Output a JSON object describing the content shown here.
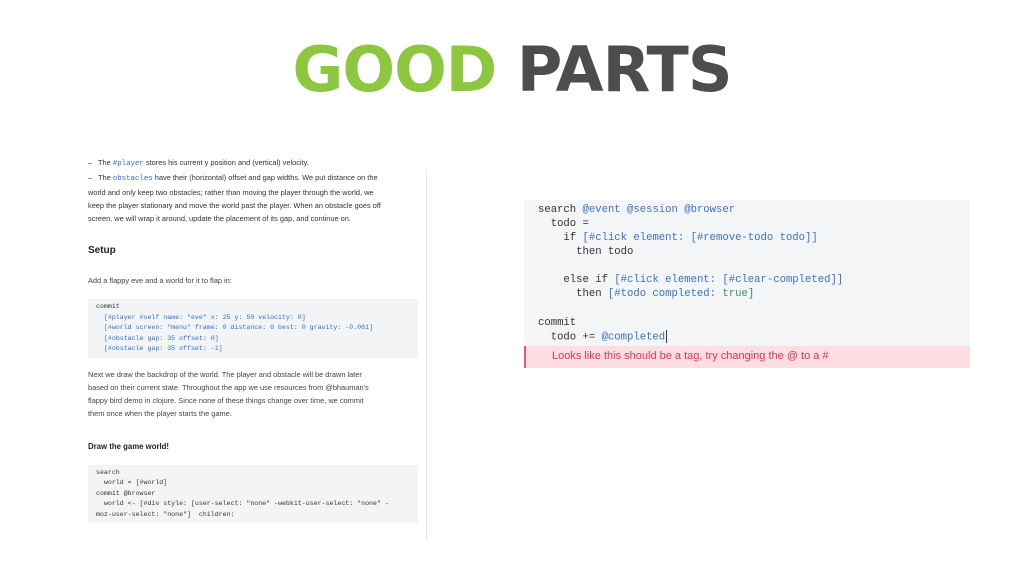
{
  "title": {
    "good": "GOOD",
    "parts": "PARTS"
  },
  "doc": {
    "bullet1": {
      "before": "The ",
      "code": "#player",
      "after": " stores his current y position and (vertical) velocity."
    },
    "bullet2": {
      "before": "The ",
      "code": "obstacles",
      "line1": " have their (horizontal) offset and gap widths. We put distance on the",
      "line2": "world and only keep two obstacles; rather than moving the player through the world, we",
      "line3": "keep the player stationary and move the world past the player. When an obstacle goes off",
      "line4": "screen, we will wrap it around, update the placement of its gap, and continue on."
    },
    "setup_heading": "Setup",
    "setup_text": "Add a flappy eve and a world for it to flap in:",
    "setup_code": [
      "commit",
      "  [#player #self name: \"eve\" x: 25 y: 50 velocity: 0]",
      "  [#world screen: \"menu\" frame: 0 distance: 0 best: 0 gravity: -0.061]",
      "  [#obstacle gap: 35 offset: 0]",
      "  [#obstacle gap: 35 offset: -1]"
    ],
    "para2": [
      "Next we draw the backdrop of the world. The player and obstacle will be drawn later",
      "based on their current state. Throughout the app we use resources from @bhauman's",
      "flappy bird demo in clojure. Since none of these things change over time, we commit",
      "them once when the player starts the game."
    ],
    "draw_heading": "Draw the game world!",
    "draw_code": [
      "search",
      "  world = [#world]",
      "",
      "commit @browser",
      "  world <- [#div style: [user-select: \"none\" -webkit-user-select: \"none\" -",
      "moz-user-select: \"none\"]  children:"
    ]
  },
  "code_panel": {
    "line1": {
      "kw": "search",
      "rest": " @event @session @browser"
    },
    "line2": "  todo =",
    "line3": {
      "kw": "    if",
      "rest": " [#click element: [#remove-todo todo]]"
    },
    "line4": {
      "kw": "      then",
      "rest": " todo"
    },
    "line5": {
      "kw": "    else if",
      "rest": " [#click element: [#clear-completed]]"
    },
    "line6": {
      "kw": "      then",
      "rest": " [#todo completed: ",
      "val": "true",
      "end": "]"
    },
    "line7": "commit",
    "line8": {
      "pre": "  todo += ",
      "val": "@completed"
    }
  },
  "error_message": "Looks like this should be a tag, try changing the @ to a #",
  "colors": {
    "good": "#8dc63f",
    "parts": "#4d4d4d",
    "error_bg": "#fbdde2",
    "error_text": "#e1384f",
    "keyword": "#3b72c8"
  }
}
